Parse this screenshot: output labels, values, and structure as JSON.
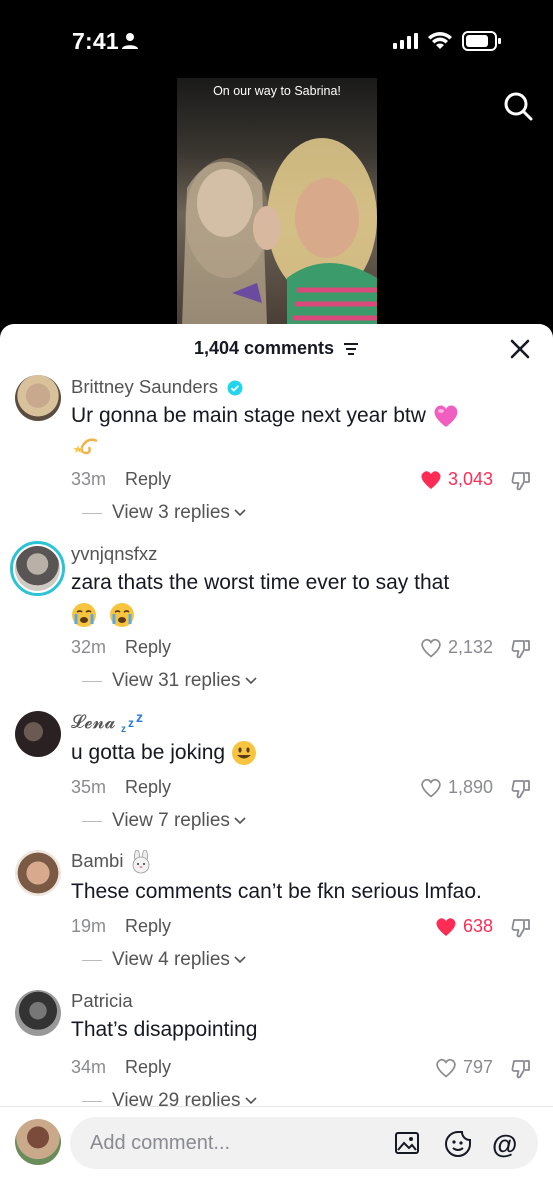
{
  "status_bar": {
    "time": "7:41"
  },
  "video": {
    "caption": "On our way to Sabrina!"
  },
  "comments_header": {
    "count_label": "1,404 comments"
  },
  "comments": [
    {
      "username": "Brittney Saunders",
      "verified": true,
      "text": "Ur gonna be main stage next year btw",
      "age": "33m",
      "reply_label": "Reply",
      "likes": "3,043",
      "liked": true,
      "view_replies": "View 3 replies"
    },
    {
      "username": "yvnjqnsfxz",
      "verified": false,
      "text": "zara thats the worst time ever to say that",
      "age": "32m",
      "reply_label": "Reply",
      "likes": "2,132",
      "liked": false,
      "view_replies": "View 31 replies"
    },
    {
      "username": "𝓛𝓮𝓷𝓪",
      "verified": false,
      "text": "u gotta be joking",
      "age": "35m",
      "reply_label": "Reply",
      "likes": "1,890",
      "liked": false,
      "view_replies": "View 7 replies"
    },
    {
      "username": "Bambi",
      "verified": false,
      "text": "These comments can’t be fkn serious lmfao.",
      "age": "19m",
      "reply_label": "Reply",
      "likes": "638",
      "liked": true,
      "view_replies": "View 4 replies"
    },
    {
      "username": "Patricia",
      "verified": false,
      "text": "That’s disappointing",
      "age": "34m",
      "reply_label": "Reply",
      "likes": "797",
      "liked": false,
      "view_replies": "View 29 replies"
    }
  ],
  "composer": {
    "placeholder": "Add comment..."
  },
  "colors": {
    "like_red": "#fe2c55",
    "verified_blue": "#20d5ec",
    "ring": "#2bc3d6"
  }
}
